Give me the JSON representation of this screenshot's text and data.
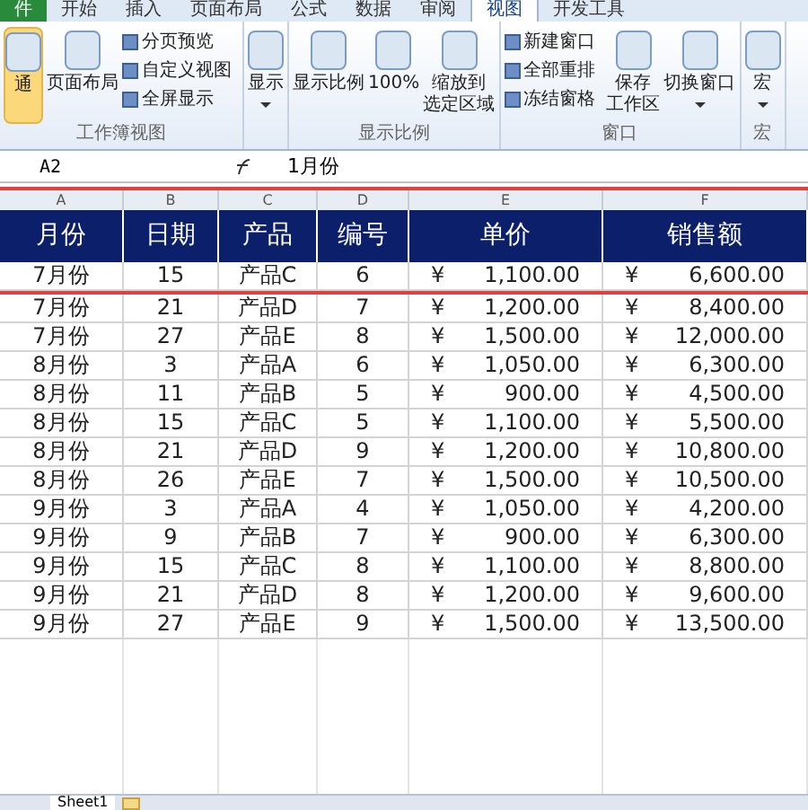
{
  "ribbon_tabs": [
    {
      "label": "件",
      "selected": false
    },
    {
      "label": "开始",
      "selected": false
    },
    {
      "label": "插入",
      "selected": false
    },
    {
      "label": "页面布局",
      "selected": false
    },
    {
      "label": "公式",
      "selected": false
    },
    {
      "label": "数据",
      "selected": false
    },
    {
      "label": "审阅",
      "selected": false
    },
    {
      "label": "视图",
      "selected": true
    },
    {
      "label": "开发工具",
      "selected": false
    }
  ],
  "ribbon_groups": [
    {
      "title": "工作簿视图",
      "big": [
        {
          "lines": [
            "通"
          ],
          "pressed": true,
          "caret": false
        },
        {
          "lines": [
            "页面布局"
          ],
          "pressed": false,
          "caret": false
        }
      ],
      "small": [
        "分页预览",
        "自定义视图",
        "全屏显示"
      ]
    },
    {
      "big": [
        {
          "lines": [
            "显示"
          ],
          "pressed": false,
          "caret": true
        }
      ]
    },
    {
      "title": "显示比例",
      "big": [
        {
          "lines": [
            "显示比例"
          ],
          "pressed": false,
          "caret": false
        },
        {
          "lines": [
            "100%"
          ],
          "pressed": false,
          "caret": false
        },
        {
          "lines": [
            "缩放到",
            "选定区域"
          ],
          "pressed": false,
          "caret": false
        }
      ]
    },
    {
      "title": "窗口",
      "small": [
        "新建窗口",
        "全部重排",
        "冻结窗格"
      ],
      "big_after": [
        {
          "lines": [
            "保存",
            "工作区"
          ],
          "pressed": false,
          "caret": false
        },
        {
          "lines": [
            "切换窗口"
          ],
          "pressed": false,
          "caret": true
        }
      ]
    },
    {
      "title": "宏",
      "big": [
        {
          "lines": [
            "宏"
          ],
          "pressed": false,
          "caret": true
        }
      ]
    }
  ],
  "name_box": "A2",
  "formula": "1月份",
  "columns": [
    "A",
    "B",
    "C",
    "D",
    "E",
    "F"
  ],
  "header": [
    "月份",
    "日期",
    "产品",
    "编号",
    "单价",
    "销售额"
  ],
  "rows": [
    [
      "7月份",
      "15",
      "产品C",
      "6",
      "1,100.00",
      "6,600.00"
    ],
    [
      "7月份",
      "21",
      "产品D",
      "7",
      "1,200.00",
      "8,400.00"
    ],
    [
      "7月份",
      "27",
      "产品E",
      "8",
      "1,500.00",
      "12,000.00"
    ],
    [
      "8月份",
      "3",
      "产品A",
      "6",
      "1,050.00",
      "6,300.00"
    ],
    [
      "8月份",
      "11",
      "产品B",
      "5",
      "900.00",
      "4,500.00"
    ],
    [
      "8月份",
      "15",
      "产品C",
      "5",
      "1,100.00",
      "5,500.00"
    ],
    [
      "8月份",
      "21",
      "产品D",
      "9",
      "1,200.00",
      "10,800.00"
    ],
    [
      "8月份",
      "26",
      "产品E",
      "7",
      "1,500.00",
      "10,500.00"
    ],
    [
      "9月份",
      "3",
      "产品A",
      "4",
      "1,050.00",
      "4,200.00"
    ],
    [
      "9月份",
      "9",
      "产品B",
      "7",
      "900.00",
      "6,300.00"
    ],
    [
      "9月份",
      "15",
      "产品C",
      "8",
      "1,100.00",
      "8,800.00"
    ],
    [
      "9月份",
      "21",
      "产品D",
      "8",
      "1,200.00",
      "9,600.00"
    ],
    [
      "9月份",
      "27",
      "产品E",
      "9",
      "1,500.00",
      "13,500.00"
    ]
  ],
  "currency": "¥",
  "sheet_tabs": [
    {
      "label": "Sheet1",
      "selected": true
    }
  ]
}
